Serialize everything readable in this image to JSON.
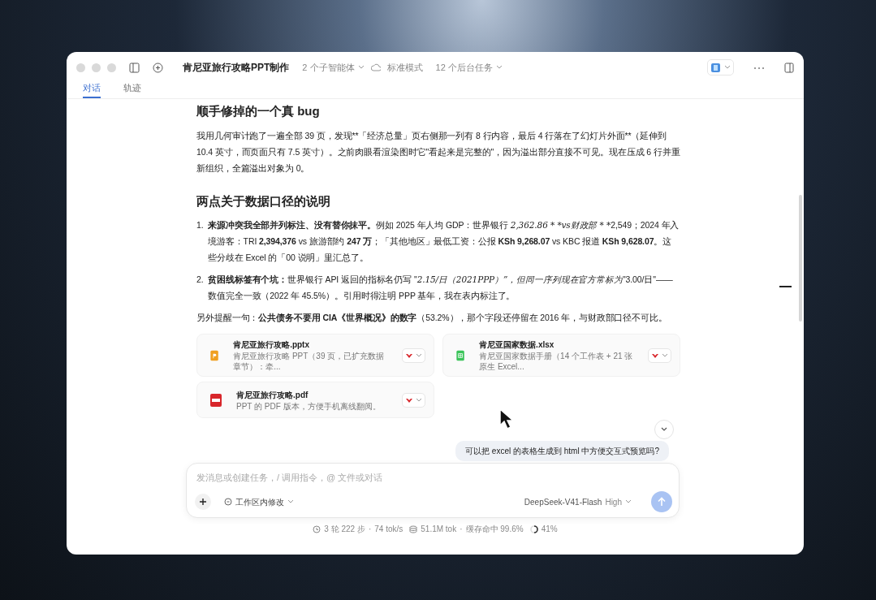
{
  "window": {
    "title": "肯尼亚旅行攻略PPT制作",
    "subagents": "2 个子智能体",
    "mode": "标准模式",
    "tasks": "12 个后台任务"
  },
  "tabs": [
    {
      "label": "对话",
      "selected": true
    },
    {
      "label": "轨迹",
      "selected": false
    }
  ],
  "sections": [
    {
      "kind": "heading",
      "text": "顺手修掉的一个真 bug"
    },
    {
      "kind": "paragraph",
      "segments": [
        {
          "kind": "plain",
          "text": "我用几何审计跑了一遍全部 39 页，发现**「经济总量」页右侧那一列有 8 行内容，最后 4 行落在了幻灯片外面**（延伸到 10.4 英寸，而页面只有 7.5 英寸）。之前肉眼看渲染图时它\"看起来是完整的\"，因为溢出部分直接不可见。现在压成 6 行并重新组织，全篇溢出对象为 0。"
        }
      ]
    },
    {
      "kind": "heading",
      "text": "两点关于数据口径的说明"
    },
    {
      "kind": "list",
      "items": [
        {
          "number": "1.",
          "segments": [
            {
              "kind": "bold",
              "text": "来源冲突我全部并列标注、没有替你抹平。"
            },
            {
              "kind": "plain",
              "text": "例如 2025 年人均 GDP：世界银行 "
            },
            {
              "kind": "math",
              "text": "2,362.86 * *vs财政部 * *"
            },
            {
              "kind": "plain",
              "text": "2,549；2024 年入境游客：TRI "
            },
            {
              "kind": "bold",
              "text": "2,394,376"
            },
            {
              "kind": "plain",
              "text": " vs 旅游部约 "
            },
            {
              "kind": "bold",
              "text": "247 万"
            },
            {
              "kind": "plain",
              "text": "；「其他地区」最低工资：公报 "
            },
            {
              "kind": "bold",
              "text": "KSh 9,268.07"
            },
            {
              "kind": "plain",
              "text": " vs KBC 报道 "
            },
            {
              "kind": "bold",
              "text": "KSh 9,628.07"
            },
            {
              "kind": "plain",
              "text": "。这些分歧在 Excel 的「00 说明」里汇总了。"
            }
          ]
        },
        {
          "number": "2.",
          "segments": [
            {
              "kind": "bold",
              "text": "贫困线标签有个坑："
            },
            {
              "kind": "plain",
              "text": "世界银行 API 返回的指标名仍写 \""
            },
            {
              "kind": "math",
              "text": "2.15/日（2021PPP）”，但同一序列现在官方常标为"
            },
            {
              "kind": "plain",
              "text": "\"3.00/日\"——数值完全一致（2022 年 45.5%）。引用时得注明 PPP 基年，我在表内标注了。"
            }
          ]
        }
      ]
    },
    {
      "kind": "paragraph",
      "segments": [
        {
          "kind": "plain",
          "text": "另外提醒一句："
        },
        {
          "kind": "bold",
          "text": "公共债务不要用 CIA《世界概况》的数字"
        },
        {
          "kind": "plain",
          "text": "（53.2%），那个字段还停留在 2016 年，与财政部口径不可比。"
        }
      ]
    }
  ],
  "files": [
    {
      "kind": "pptx",
      "name": "肯尼亚旅行攻略.pptx",
      "description": "肯尼亚旅行攻略 PPT（39 页，已扩充数据章节）：牵..."
    },
    {
      "kind": "xlsx",
      "name": "肯尼亚国家数据.xlsx",
      "description": "肯尼亚国家数据手册（14 个工作表 + 21 张原生 Excel..."
    },
    {
      "kind": "pdf",
      "name": "肯尼亚旅行攻略.pdf",
      "description": "PPT 的 PDF 版本，方便手机离线翻阅。"
    }
  ],
  "user_message": "可以把 excel 的表格生成到 html 中方便交互式预览吗?",
  "composer": {
    "placeholder": "发消息或创建任务，/ 调用指令，@ 文件或对话",
    "scope": "工作区内修改",
    "model": "DeepSeek-V41-Flash",
    "effort": "High"
  },
  "status_bar": {
    "steps": "3 轮 222 步",
    "separator_1": "·",
    "speed": "74 tok/s",
    "tokens": "51.1M tok",
    "separator_2": "·",
    "cache": "缓存命中 99.6%",
    "context": "41%"
  }
}
